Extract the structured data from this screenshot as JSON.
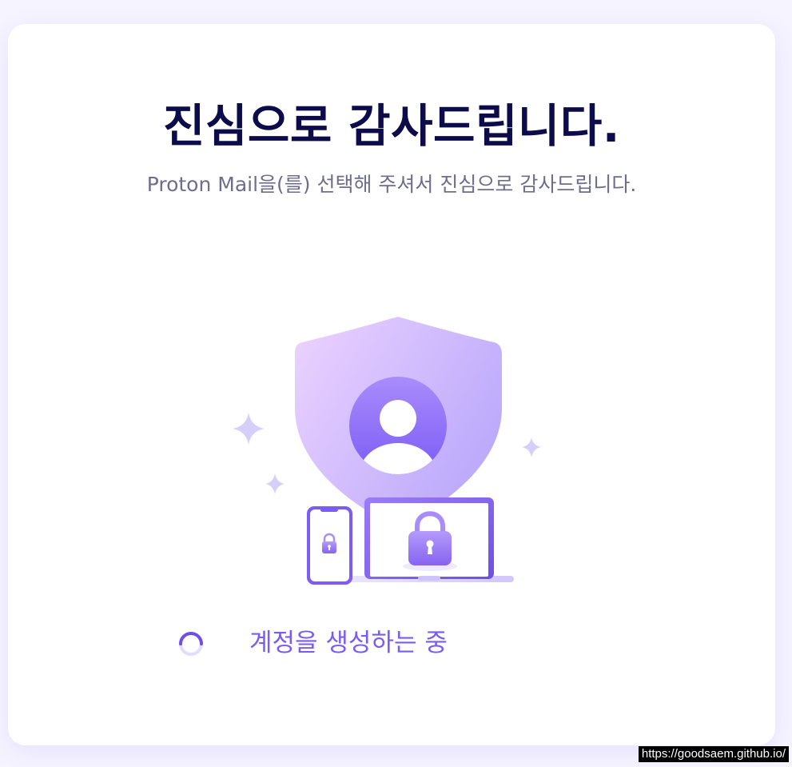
{
  "header": {
    "title": "진심으로 감사드립니다.",
    "subtitle": "Proton Mail을(를) 선택해 주셔서 진심으로 감사드립니다."
  },
  "illustration": {
    "icons": [
      "shield-icon",
      "user-avatar-icon",
      "smartphone-icon",
      "laptop-icon",
      "padlock-icon",
      "sparkle-icon"
    ]
  },
  "status": {
    "text": "계정을 생성하는 중",
    "icon": "loading-spinner-icon"
  },
  "url_badge": "https://goodsaem.github.io/",
  "colors": {
    "background": "#f6f4ff",
    "card": "#ffffff",
    "title": "#0c0c4a",
    "subtitle": "#6d6d8c",
    "accent": "#7a5cf0"
  }
}
